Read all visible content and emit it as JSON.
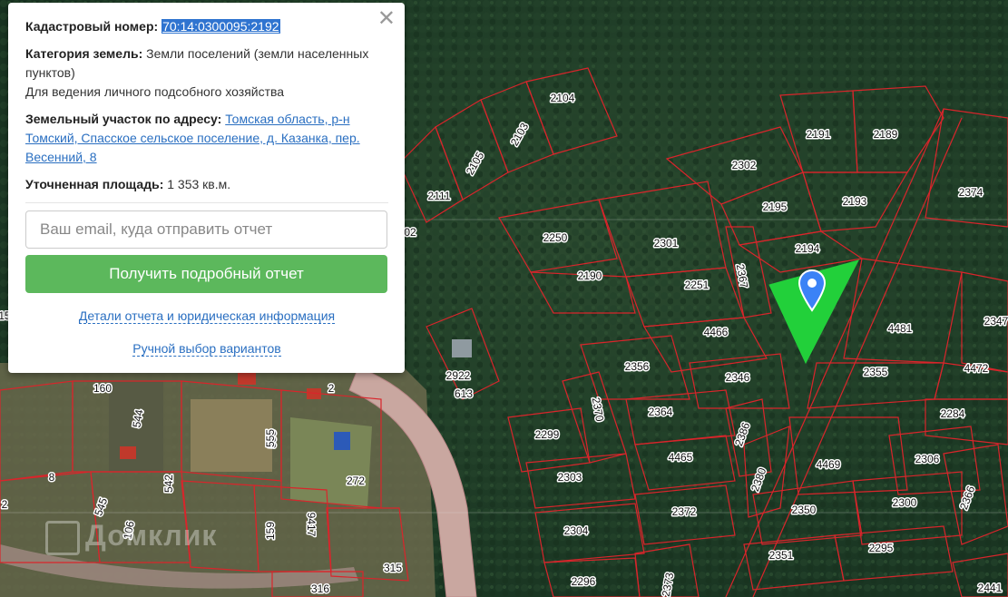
{
  "popup": {
    "cad_label": "Кадастровый номер:",
    "cad_number": "70:14:0300095:2192",
    "category_label": "Категория земель:",
    "category_value": "Земли поселений (земли населенных пунктов)",
    "usage": "Для ведения личного подсобного хозяйства",
    "address_label": "Земельный участок по адресу:",
    "address_value": "Томская область, р-н Томский, Спасское сельское поселение, д. Казанка, пер. Весенний, 8",
    "area_label": "Уточненная площадь:",
    "area_value": "1 353 кв.м.",
    "email_placeholder": "Ваш email, куда отправить отчет",
    "report_button": "Получить подробный отчет",
    "details_link": "Детали отчета и юридическая информация",
    "manual_link": "Ручной выбор вариантов",
    "close_icon": "close-icon"
  },
  "map": {
    "watermark": "Домклик",
    "marker_icon": "map-pin-icon",
    "highlight_color": "#22d03a",
    "boundary_color": "#d9252b",
    "plot_labels": [
      "2104",
      "2103",
      "2105",
      "2111",
      "02",
      "2191",
      "2189",
      "2302",
      "2374",
      "2195",
      "2193",
      "2250",
      "2301",
      "2194",
      "2190",
      "2367",
      "2251",
      "4481",
      "2347",
      "4466",
      "2356",
      "2346",
      "2355",
      "4472",
      "2922",
      "613",
      "2370",
      "2364",
      "2284",
      "2299",
      "2386",
      "4465",
      "4469",
      "2306",
      "2303",
      "2380",
      "2300",
      "2372",
      "2350",
      "2366",
      "2304",
      "2351",
      "2295",
      "2373",
      "2296",
      "2441",
      "160",
      "544",
      "555",
      "2",
      "8",
      "555",
      "542",
      "272",
      "545",
      "106",
      "159",
      "9417",
      "315",
      "316",
      "15",
      "2"
    ]
  }
}
